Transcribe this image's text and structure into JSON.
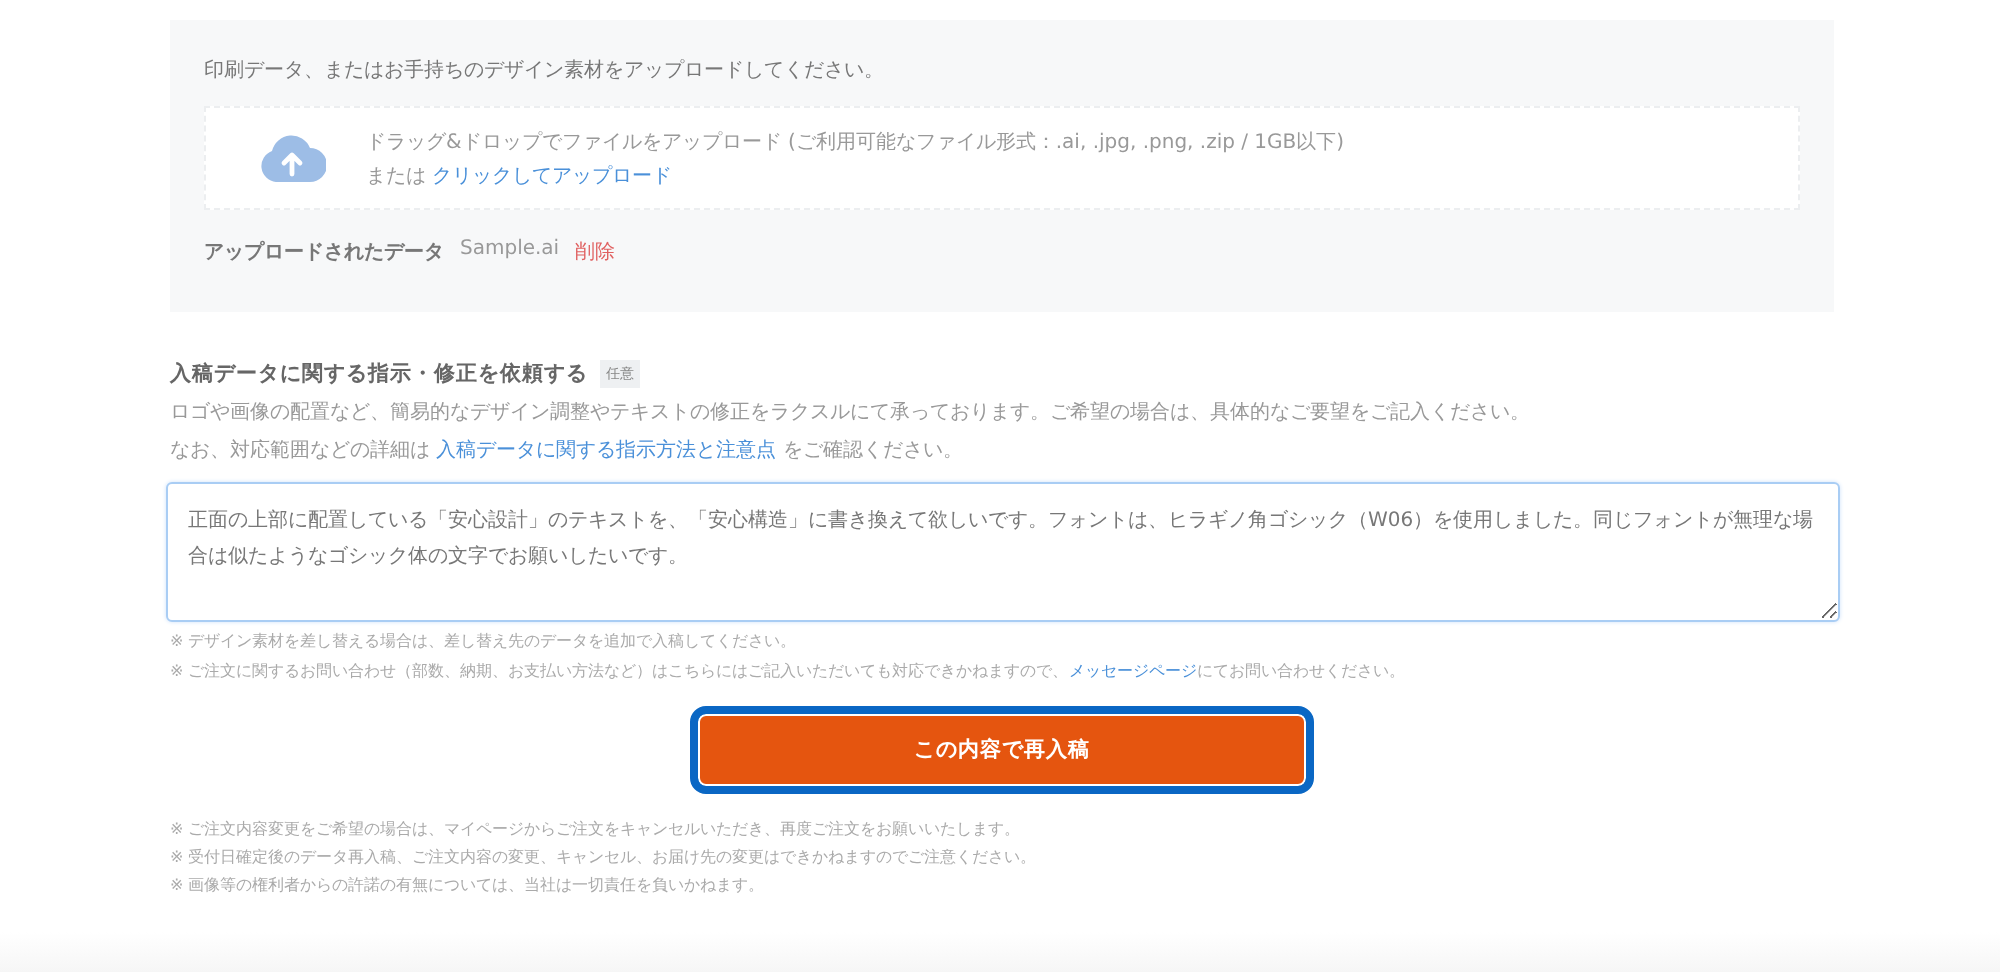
{
  "upload": {
    "intro": "印刷データ、またはお手持ちのデザイン素材をアップロードしてください。",
    "dropzone": {
      "hint": "ドラッグ&ドロップでファイルをアップロード (ご利用可能なファイル形式：.ai, .jpg, .png, .zip / 1GB以下)",
      "or": "または",
      "link": "クリックしてアップロード"
    },
    "uploaded": {
      "label": "アップロードされたデータ",
      "file": "Sample.ai",
      "delete": "削除"
    }
  },
  "instructions": {
    "title": "入稿データに関する指示・修正を依頼する",
    "badge": "任意",
    "description": "ロゴや画像の配置など、簡易的なデザイン調整やテキストの修正をラクスルにて承っております。ご希望の場合は、具体的なご要望をご記入ください。",
    "detail": {
      "before": "なお、対応範囲などの詳細は",
      "link": "入稿データに関する指示方法と注意点",
      "after": "をご確認ください。"
    },
    "value": "正面の上部に配置している「安心設計」のテキストを、「安心構造」に書き換えて欲しいです。フォントは、ヒラギノ角ゴシック（W06）を使用しました。同じフォントが無理な場合は似たようなゴシック体の文字でお願いしたいです。",
    "notes": [
      {
        "text": "※ デザイン素材を差し替える場合は、差し替え先のデータを追加で入稿してください。"
      },
      {
        "text": "※ ご注文に関するお問い合わせ（部数、納期、お支払い方法など）はこちらにはご記入いただいても対応できかねますので、",
        "link": "メッセージページ",
        "after": "にてお問い合わせください。"
      }
    ]
  },
  "submit": {
    "label": "この内容で再入稿",
    "focused": true
  },
  "footer_notes": [
    "※ ご注文内容変更をご希望の場合は、マイページからご注文をキャンセルいただき、再度ご注文をお願いいたします。",
    "※ 受付日確定後のデータ再入稿、ご注文内容の変更、キャンセル、お届け先の変更はできかねますのでご注意ください。",
    "※ 画像等の権利者からの許諾の有無については、当社は一切責任を負いかねます。"
  ]
}
